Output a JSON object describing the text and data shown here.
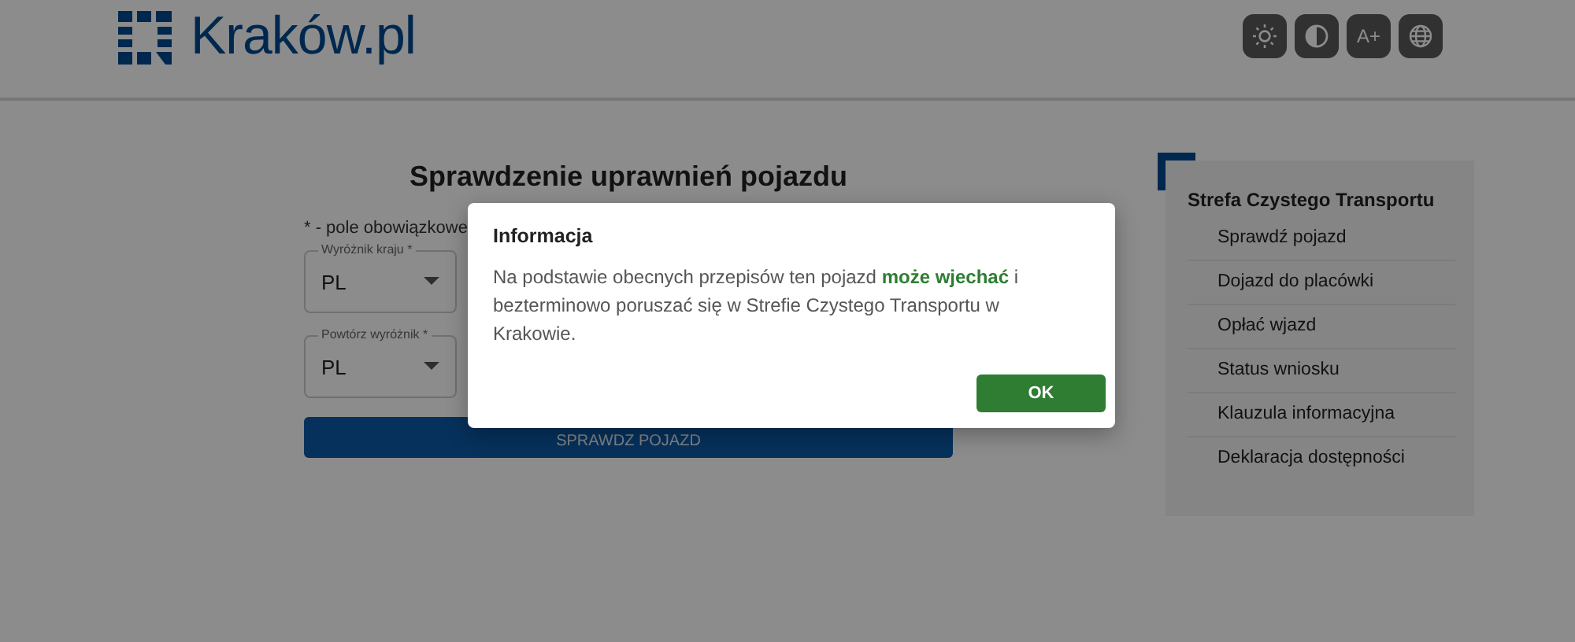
{
  "header": {
    "logo_text": "Kraków.pl",
    "tool_buttons": [
      {
        "kind": "sun"
      },
      {
        "kind": "contrast"
      },
      {
        "kind": "text",
        "label": "A+"
      },
      {
        "kind": "globe"
      }
    ]
  },
  "form": {
    "title": "Sprawdzenie uprawnień pojazdu",
    "required_note": "* - pole obowiązkowe",
    "fields": [
      {
        "label": "Wyróżnik kraju *",
        "value": "PL"
      },
      {
        "label": "Powtórz wyróżnik *",
        "value": "PL"
      }
    ],
    "submit_button": "SPRAWDZ POJAZD"
  },
  "sidebar": {
    "title": "Strefa Czystego Transportu",
    "items": [
      "Sprawdź pojazd",
      "Dojazd do placówki",
      "Opłać wjazd",
      "Status wniosku",
      "Klauzula informacyjna",
      "Deklaracja dostępności"
    ]
  },
  "dialog": {
    "title": "Informacja",
    "message": "Na podstawie obecnych przepisów ten pojazd **może wjechać** i bezterminowo poruszać się w Strefie Czystego Transportu w Krakowie.",
    "ok_button": "OK"
  }
}
